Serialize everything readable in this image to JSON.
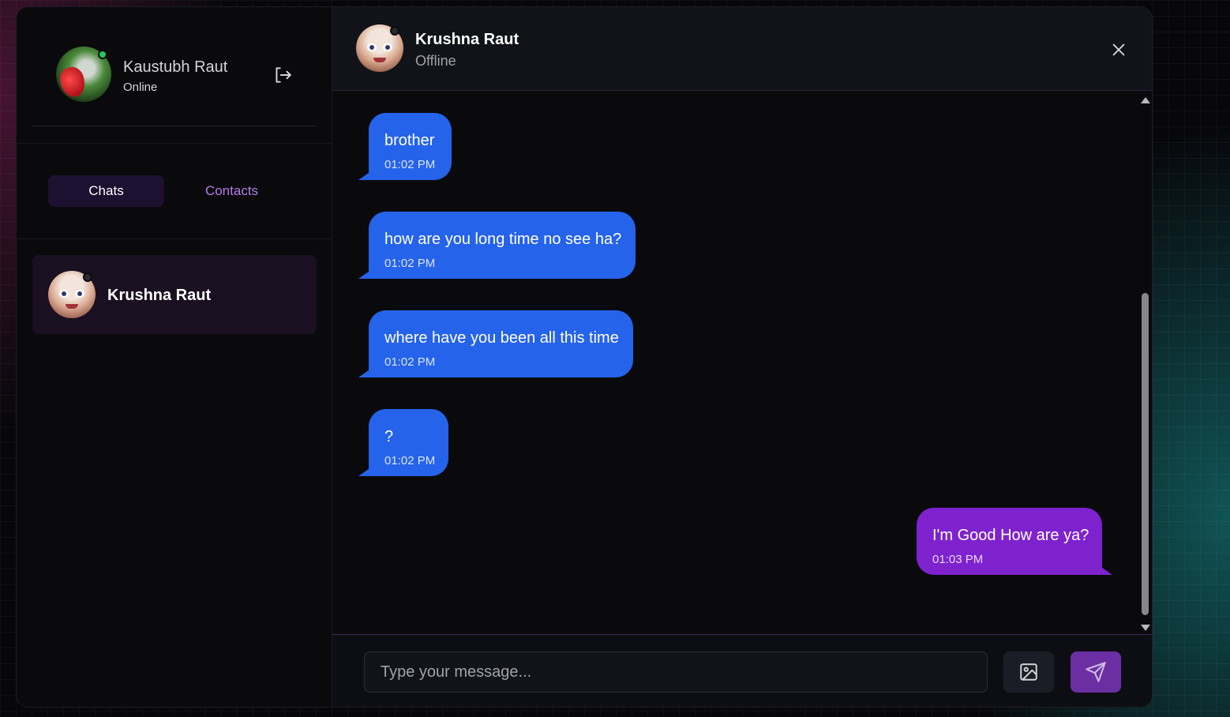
{
  "current_user": {
    "name": "Kaustubh Raut",
    "status": "Online"
  },
  "sidebar": {
    "tabs": [
      {
        "label": "Chats",
        "active": true
      },
      {
        "label": "Contacts",
        "active": false
      }
    ],
    "chats": [
      {
        "name": "Krushna Raut"
      }
    ]
  },
  "conversation": {
    "contact_name": "Krushna Raut",
    "contact_status": "Offline",
    "messages": [
      {
        "text": "brother",
        "time": "01:02 PM",
        "direction": "incoming"
      },
      {
        "text": "how are you long time no see ha?",
        "time": "01:02 PM",
        "direction": "incoming"
      },
      {
        "text": "where have you been all this time",
        "time": "01:02 PM",
        "direction": "incoming"
      },
      {
        "text": "?",
        "time": "01:02 PM",
        "direction": "incoming"
      },
      {
        "text": "I'm Good How are ya?",
        "time": "01:03 PM",
        "direction": "outgoing"
      }
    ]
  },
  "composer": {
    "placeholder": "Type your message..."
  },
  "icons": {
    "logout": "logout-icon",
    "close": "close-icon",
    "image": "image-icon",
    "send": "send-icon"
  },
  "colors": {
    "incoming_bubble": "#2563eb",
    "outgoing_bubble": "#7e22ce",
    "accent_purple": "#b57be6",
    "online": "#22c55e"
  }
}
